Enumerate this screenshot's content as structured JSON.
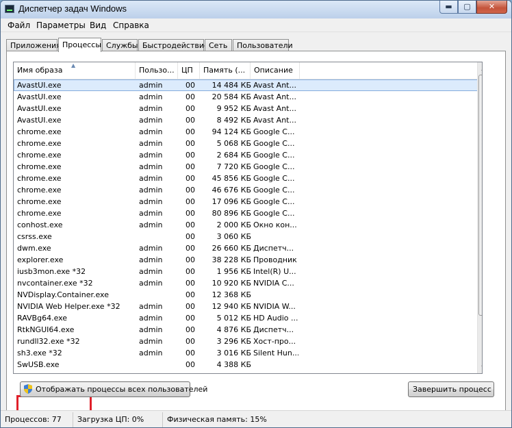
{
  "window": {
    "title": "Диспетчер задач Windows",
    "caption_minimize": "▬",
    "caption_maximize": "▢",
    "caption_close": "✕"
  },
  "menu": [
    "Файл",
    "Параметры",
    "Вид",
    "Справка"
  ],
  "tabs": [
    "Приложения",
    "Процессы",
    "Службы",
    "Быстродействие",
    "Сеть",
    "Пользователи"
  ],
  "active_tab": "Процессы",
  "columns": [
    "Имя образа",
    "Пользо...",
    "ЦП",
    "Память (...",
    "Описание"
  ],
  "processes": [
    {
      "name": "AvastUI.exe",
      "user": "admin",
      "cpu": "00",
      "mem": "14 484 КБ",
      "desc": "Avast Ant..."
    },
    {
      "name": "AvastUI.exe",
      "user": "admin",
      "cpu": "00",
      "mem": "20 584 КБ",
      "desc": "Avast Ant..."
    },
    {
      "name": "AvastUI.exe",
      "user": "admin",
      "cpu": "00",
      "mem": "9 952 КБ",
      "desc": "Avast Ant..."
    },
    {
      "name": "AvastUI.exe",
      "user": "admin",
      "cpu": "00",
      "mem": "8 492 КБ",
      "desc": "Avast Ant..."
    },
    {
      "name": "chrome.exe",
      "user": "admin",
      "cpu": "00",
      "mem": "94 124 КБ",
      "desc": "Google C..."
    },
    {
      "name": "chrome.exe",
      "user": "admin",
      "cpu": "00",
      "mem": "5 068 КБ",
      "desc": "Google C..."
    },
    {
      "name": "chrome.exe",
      "user": "admin",
      "cpu": "00",
      "mem": "2 684 КБ",
      "desc": "Google C..."
    },
    {
      "name": "chrome.exe",
      "user": "admin",
      "cpu": "00",
      "mem": "7 720 КБ",
      "desc": "Google C..."
    },
    {
      "name": "chrome.exe",
      "user": "admin",
      "cpu": "00",
      "mem": "45 856 КБ",
      "desc": "Google C..."
    },
    {
      "name": "chrome.exe",
      "user": "admin",
      "cpu": "00",
      "mem": "46 676 КБ",
      "desc": "Google C..."
    },
    {
      "name": "chrome.exe",
      "user": "admin",
      "cpu": "00",
      "mem": "17 096 КБ",
      "desc": "Google C..."
    },
    {
      "name": "chrome.exe",
      "user": "admin",
      "cpu": "00",
      "mem": "80 896 КБ",
      "desc": "Google C..."
    },
    {
      "name": "conhost.exe",
      "user": "admin",
      "cpu": "00",
      "mem": "2 000 КБ",
      "desc": "Окно кон..."
    },
    {
      "name": "csrss.exe",
      "user": "",
      "cpu": "00",
      "mem": "3 060 КБ",
      "desc": ""
    },
    {
      "name": "dwm.exe",
      "user": "admin",
      "cpu": "00",
      "mem": "26 660 КБ",
      "desc": "Диспетч..."
    },
    {
      "name": "explorer.exe",
      "user": "admin",
      "cpu": "00",
      "mem": "38 228 КБ",
      "desc": "Проводник"
    },
    {
      "name": "iusb3mon.exe *32",
      "user": "admin",
      "cpu": "00",
      "mem": "1 956 КБ",
      "desc": "Intel(R) U..."
    },
    {
      "name": "nvcontainer.exe *32",
      "user": "admin",
      "cpu": "00",
      "mem": "10 920 КБ",
      "desc": "NVIDIA C..."
    },
    {
      "name": "NVDisplay.Container.exe",
      "user": "",
      "cpu": "00",
      "mem": "12 368 КБ",
      "desc": ""
    },
    {
      "name": "NVIDIA Web Helper.exe *32",
      "user": "admin",
      "cpu": "00",
      "mem": "12 940 КБ",
      "desc": "NVIDIA W..."
    },
    {
      "name": "RAVBg64.exe",
      "user": "admin",
      "cpu": "00",
      "mem": "5 012 КБ",
      "desc": "HD Audio ..."
    },
    {
      "name": "RtkNGUI64.exe",
      "user": "admin",
      "cpu": "00",
      "mem": "4 876 КБ",
      "desc": "Диспетч..."
    },
    {
      "name": "rundll32.exe *32",
      "user": "admin",
      "cpu": "00",
      "mem": "3 296 КБ",
      "desc": "Хост-про..."
    },
    {
      "name": "sh3.exe *32",
      "user": "admin",
      "cpu": "00",
      "mem": "3 016 КБ",
      "desc": "Silent Hun..."
    },
    {
      "name": "SwUSB.exe",
      "user": "",
      "cpu": "00",
      "mem": "4 388 КБ",
      "desc": ""
    }
  ],
  "buttons": {
    "show_all": "Отображать процессы всех пользователей",
    "end_process": "Завершить процесс"
  },
  "status": {
    "processes": "Процессов: 77",
    "cpu": "Загрузка ЦП: 0%",
    "memory": "Физическая память: 15%"
  },
  "colors": {
    "selection": "#dcebfc",
    "highlight_box": "#e0202a"
  }
}
